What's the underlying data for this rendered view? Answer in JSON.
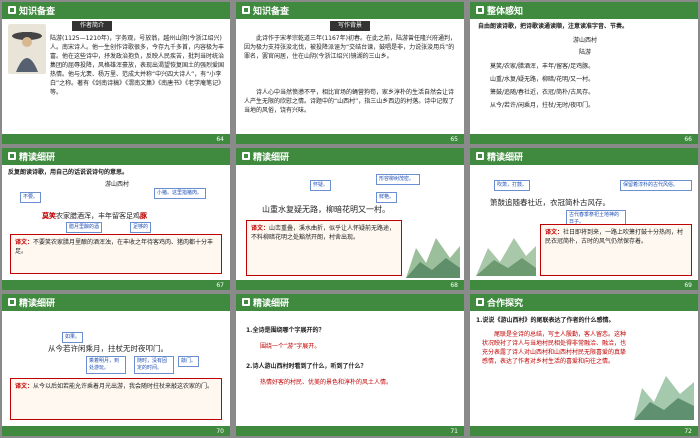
{
  "slides": [
    {
      "title": "知识备查",
      "page": "64",
      "badge": "作者简介",
      "body": "陆游(1125—1210年)，字务观，号放翁，越州山阴(今浙江绍兴)人。南宋诗人。他一生创作诗歌很多，今存九千多首，内容极为丰富。他在这些诗中，抒发政治抱负，反映人民疾苦，批判当时统治集团的屈辱投降，风格雄浑豪放，表现出渴望恢复国土的强烈爱国热情。他与尤袤、杨万里、范成大并称“中兴四大诗人”，有“小李白”之称。著有《剑南诗稿》《渭南文集》《南唐书》《老学庵笔记》等。",
      "highlight": "陆游"
    },
    {
      "title": "知识备查",
      "page": "65",
      "badge": "写作背景",
      "body1": "此诗作于宋孝宗乾道三年(1167年)初春。在此之前，陆游曾任隆兴府通判，因为极力支持张浚北伐，被投降派诬为“交结台谏，鼓唱是非，力说张浚用兵”的罪名，罢官闲居，住在山阴(今浙江绍兴)镜湖的三山乡。",
      "body2": "诗人心中当然愤懑不平，相比官场的蝇营狗苟，家乡淳朴的生活自然会让诗人产生无限的欣慰之情。诗题中的“山西村”，指三山乡西边的村落。诗中记叙了当地的风俗，饶有兴味。"
    },
    {
      "title": "整体感知",
      "page": "66",
      "intro": "自由朗读诗歌，把诗歌读通读顺，注意读准字音、节奏。",
      "poem_title": "游山西村",
      "author": "陆游",
      "lines": [
        "莫笑/农家/腊酒浑，丰年/留客/足鸡豚。",
        "山重/水复/疑无路，柳暗/花明/又一村。",
        "箫鼓/追随/春社近，衣冠/简朴/古风存。",
        "从今/若许/闲乘月，拄杖/无时/夜叩门。"
      ]
    },
    {
      "title": "精读细研",
      "page": "67",
      "question": "反复朗读诗歌，用自己的话说说诗句的意思。",
      "poem_title": "游山西村",
      "note1": "不要。",
      "note2": "小猪。这里指猪肉。",
      "line_a": "莫笑",
      "line_b": "农家腊酒浑，丰年留客足鸡",
      "line_c": "豚",
      "note3": "腊月里酿的酒",
      "note4": "足够的",
      "translation_label": "译文：",
      "translation": "不要笑农家腊月里酿的酒浑浊，在丰收之年待客鸡肉、猪肉都十分丰足。"
    },
    {
      "title": "精读细研",
      "page": "68",
      "note1": "怀疑。",
      "note2": "形容柳树茂密。",
      "note3": "鲜艳。",
      "line": "山重水复疑无路，柳暗花明又一村。",
      "translation_label": "译文：",
      "translation": "山峦重叠，溪水曲折，似乎让人怀疑前无路途，不料柳暗花明之处豁然开朗，村舍出现。"
    },
    {
      "title": "精读细研",
      "page": "69",
      "note1": "吹箫，打鼓。",
      "note2": "保留着淳朴的古代风俗。",
      "note3": "古代春季祭祀土地神的日子。",
      "line": "箫鼓追随春社近，衣冠简朴古风存。",
      "translation_label": "译文：",
      "translation": "社日即将到来，一路上吹箫打鼓十分热闹，村民衣冠简朴，古时的风气仍然保存着。"
    },
    {
      "title": "精读细研",
      "page": "70",
      "note1": "如果。",
      "note2": "乘着明月，到处游玩。",
      "note3": "随时，没有固定的时间。",
      "note4": "敲门。",
      "line": "从今若许闲乘月，拄杖无时夜叩门。",
      "translation_label": "译文：",
      "translation": "从今以后如若能允许乘着月光出游，我会随时拄杖来敲这农家的门。"
    },
    {
      "title": "精读细研",
      "page": "71",
      "q1": "1.全诗是围绕哪个字展开的？",
      "a1": "围绕一个“游”字展开。",
      "q2": "2.诗人游山西村时看到了什么，听到了什么？",
      "a2": "热情好客的村民、优美的景色和淳朴的风土人情。"
    },
    {
      "title": "合作探究",
      "page": "72",
      "question": "1.说说《游山西村》的尾联表达了作者的什么感情。",
      "answer": "尾联是全诗的总结，写主人殷勤，客人留恋。这种状况映衬了诗人与当地村民相处得非常融洽、融洽，也充分表露了诗人对山西村和山西村村民无限喜爱的真挚感情，表达了作者对乡村生活的喜爱和向往之情。"
    }
  ]
}
